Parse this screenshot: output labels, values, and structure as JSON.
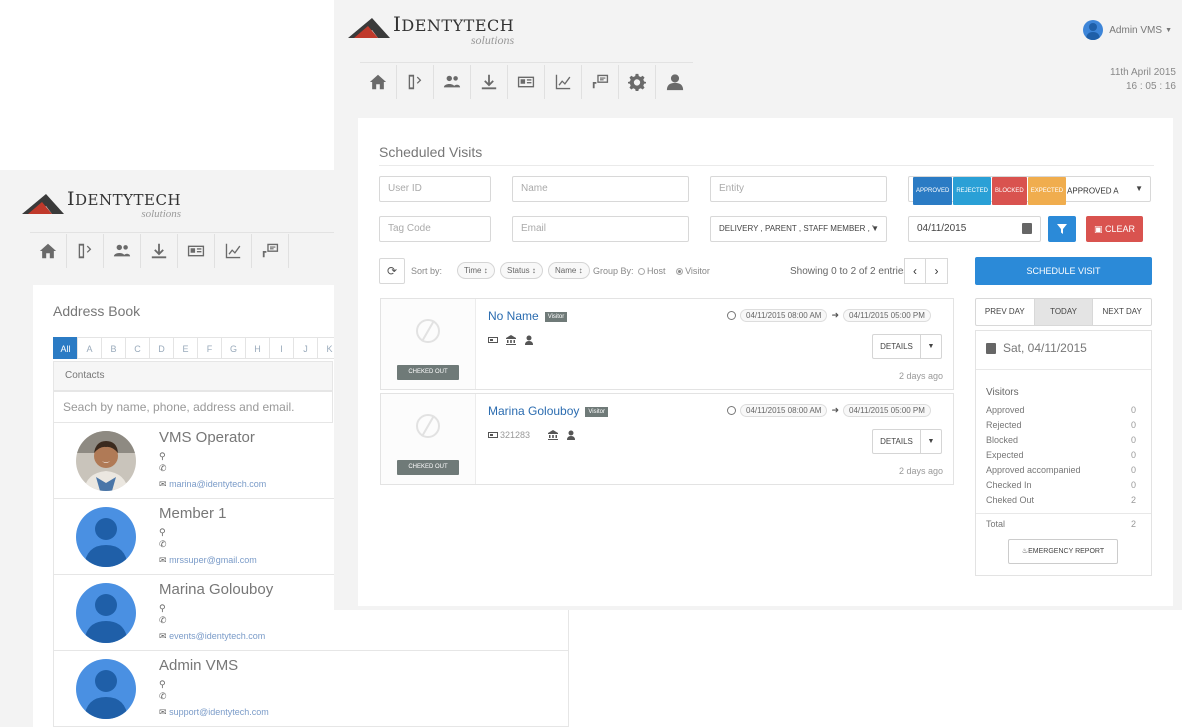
{
  "brand": {
    "name_initial": "I",
    "name_rest": "DENTYTECH",
    "sub": "solutions",
    "colors": {
      "mark_dark": "#3a3a3a",
      "mark_red": "#c0392b"
    }
  },
  "nav_icons": [
    "home-icon",
    "visits-icon",
    "users-icon",
    "download-icon",
    "id-card-icon",
    "chart-icon",
    "badge-icon",
    "gear-icon",
    "user-icon"
  ],
  "address_book": {
    "title": "Address Book",
    "alphabet": [
      "All",
      "A",
      "B",
      "C",
      "D",
      "E",
      "F",
      "G",
      "H",
      "I",
      "J",
      "K"
    ],
    "contacts_header": "Contacts",
    "search_placeholder": "Seach by name, phone, address and email.",
    "contacts": [
      {
        "name": "VMS Operator",
        "email": "marina@identytech.com"
      },
      {
        "name": "Member 1",
        "email": "mrssuper@gmail.com"
      },
      {
        "name": "Marina Golouboy",
        "email": "events@identytech.com"
      },
      {
        "name": "Admin VMS",
        "email": "support@identytech.com"
      }
    ]
  },
  "header": {
    "user": "Admin VMS",
    "date": "11th April 2015",
    "time": "16 : 05 : 16"
  },
  "scheduled": {
    "title": "Scheduled Visits",
    "fields": {
      "user_id": "User ID",
      "name": "Name",
      "entity": "Entity",
      "tag_code": "Tag Code",
      "email": "Email",
      "types": "DELIVERY , PARENT , STAFF MEMBER , '",
      "date": "04/11/2015"
    },
    "status_badges": [
      "APPROVED",
      "REJECTED",
      "BLOCKED",
      "EXPECTED"
    ],
    "status_value": "APPROVED A",
    "clear_label": "CLEAR",
    "sort_by": "Sort by:",
    "sort_pills": [
      "Time ↕",
      "Status ↕",
      "Name ↕"
    ],
    "group_by": "Group By:",
    "group_host": "Host",
    "group_visitor": "Visitor",
    "showing": "Showing 0 to 2 of 2 entries",
    "pager_prev": "‹",
    "pager_next": "›",
    "schedule_label": "SCHEDULE VISIT",
    "visits": [
      {
        "name": "No Name",
        "badge": "Visitor",
        "code": "",
        "status": "CHEKED OUT",
        "from": "04/11/2015 08:00 AM",
        "to": "04/11/2015 05:00 PM",
        "details": "DETAILS",
        "ago": "2 days ago"
      },
      {
        "name": "Marina Golouboy",
        "badge": "Visitor",
        "code": "321283",
        "status": "CHEKED OUT",
        "from": "04/11/2015 08:00 AM",
        "to": "04/11/2015 05:00 PM",
        "details": "DETAILS",
        "ago": "2 days ago"
      }
    ]
  },
  "sidebar": {
    "prev": "PREV DAY",
    "today": "TODAY",
    "next": "NEXT DAY",
    "date": "Sat, 04/11/2015",
    "visitors_title": "Visitors",
    "stats": [
      {
        "label": "Approved",
        "value": "0"
      },
      {
        "label": "Rejected",
        "value": "0"
      },
      {
        "label": "Blocked",
        "value": "0"
      },
      {
        "label": "Expected",
        "value": "0"
      },
      {
        "label": "Approved accompanied",
        "value": "0"
      },
      {
        "label": "Checked In",
        "value": "0"
      },
      {
        "label": "Cheked Out",
        "value": "2"
      }
    ],
    "total_label": "Total",
    "total_value": "2",
    "emergency": "EMERGENCY REPORT"
  }
}
